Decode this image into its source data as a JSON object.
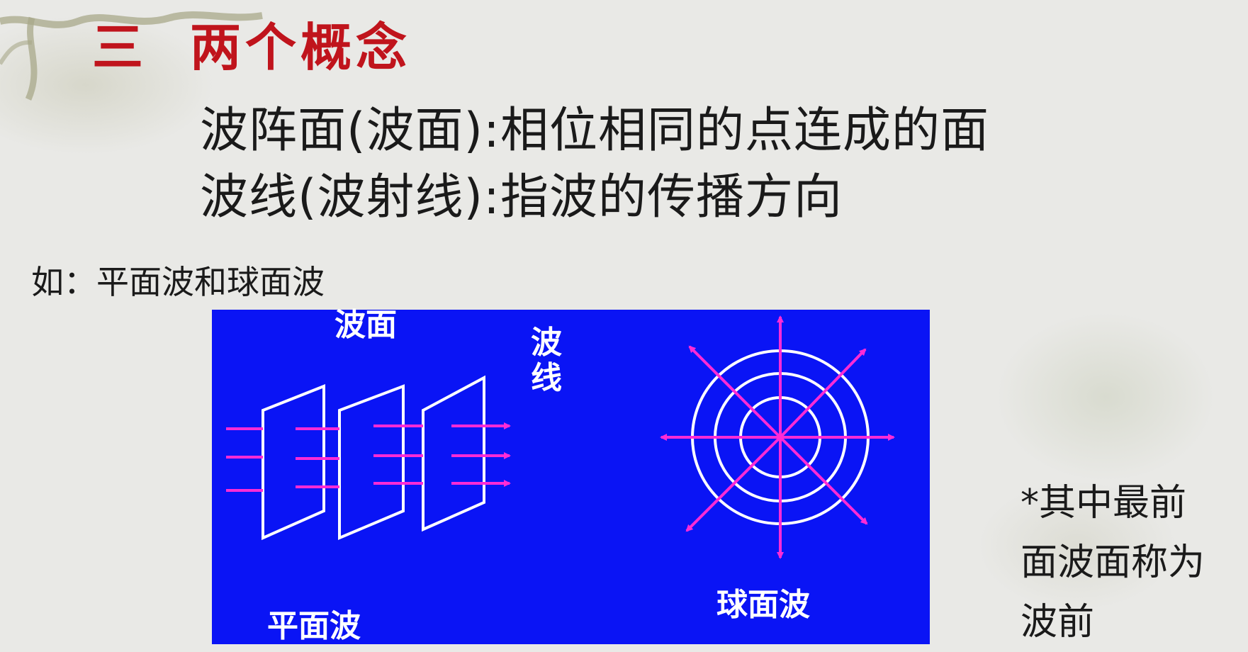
{
  "slide": {
    "title_num": "三",
    "title_text": "两个概念",
    "definition_1": "波阵面(波面):相位相同的点连成的面",
    "definition_2": "波线(波射线):指波的传播方向",
    "example_intro": "如：平面波和球面波",
    "figure": {
      "label_wavefront": "波面",
      "label_ray_line1": "波",
      "label_ray_line2": "线",
      "label_plane_wave": "平面波",
      "label_spherical_wave": "球面波"
    },
    "note_line1": "*其中最前",
    "note_line2": "面波面称为",
    "note_line3": "波前"
  },
  "colors": {
    "title": "#c0141c",
    "figure_bg": "#0a14f5",
    "ray": "#ff2bd6",
    "wavefront": "#ffffff"
  }
}
